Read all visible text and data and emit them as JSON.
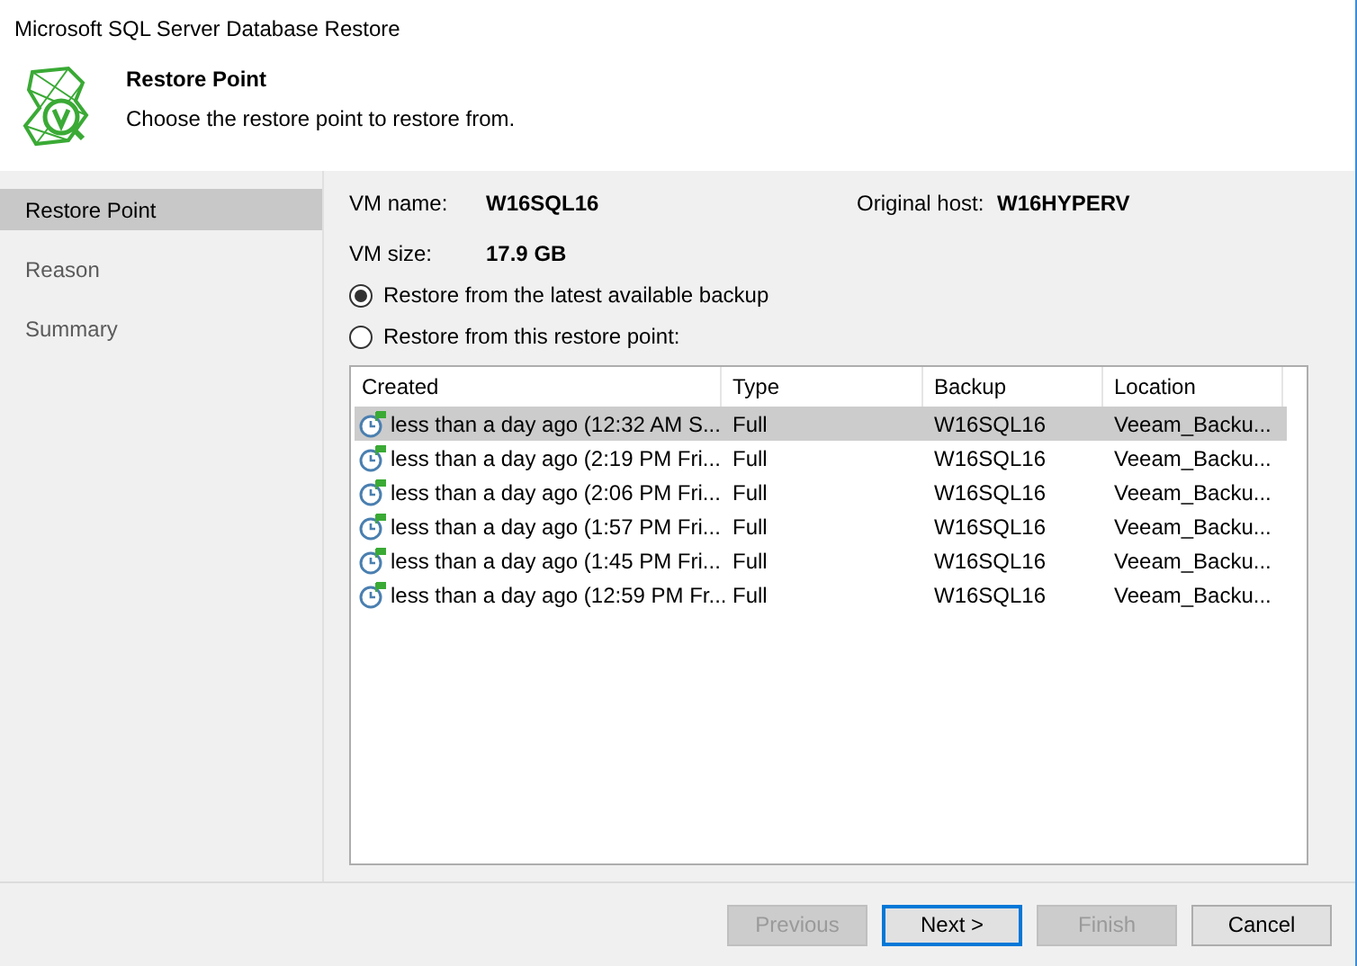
{
  "window": {
    "title": "Microsoft SQL Server Database Restore"
  },
  "header": {
    "title": "Restore Point",
    "subtitle": "Choose the restore point to restore from."
  },
  "steps": [
    {
      "label": "Restore Point",
      "selected": true
    },
    {
      "label": "Reason",
      "selected": false
    },
    {
      "label": "Summary",
      "selected": false
    }
  ],
  "vm": {
    "name_label": "VM name:",
    "name": "W16SQL16",
    "host_label": "Original host:",
    "host": "W16HYPERV",
    "size_label": "VM size:",
    "size": "17.9 GB"
  },
  "options": [
    {
      "label": "Restore from the latest available backup",
      "selected": true
    },
    {
      "label": "Restore from this restore point:",
      "selected": false
    }
  ],
  "table": {
    "columns": [
      "Created",
      "Type",
      "Backup",
      "Location"
    ],
    "rows": [
      {
        "cells": [
          "less than a day ago (12:32 AM S...",
          "Full",
          "W16SQL16",
          "Veeam_Backu..."
        ],
        "selected": true
      },
      {
        "cells": [
          "less than a day ago (2:19 PM Fri...",
          "Full",
          "W16SQL16",
          "Veeam_Backu..."
        ],
        "selected": false
      },
      {
        "cells": [
          "less than a day ago (2:06 PM Fri...",
          "Full",
          "W16SQL16",
          "Veeam_Backu..."
        ],
        "selected": false
      },
      {
        "cells": [
          "less than a day ago (1:57 PM Fri...",
          "Full",
          "W16SQL16",
          "Veeam_Backu..."
        ],
        "selected": false
      },
      {
        "cells": [
          "less than a day ago (1:45 PM Fri...",
          "Full",
          "W16SQL16",
          "Veeam_Backu..."
        ],
        "selected": false
      },
      {
        "cells": [
          "less than a day ago (12:59 PM Fr...",
          "Full",
          "W16SQL16",
          "Veeam_Backu..."
        ],
        "selected": false
      }
    ]
  },
  "buttons": [
    {
      "label": "Previous",
      "disabled": true,
      "default": false
    },
    {
      "label": "Next >",
      "disabled": false,
      "default": true
    },
    {
      "label": "Finish",
      "disabled": true,
      "default": false
    },
    {
      "label": "Cancel",
      "disabled": false,
      "default": false
    }
  ]
}
